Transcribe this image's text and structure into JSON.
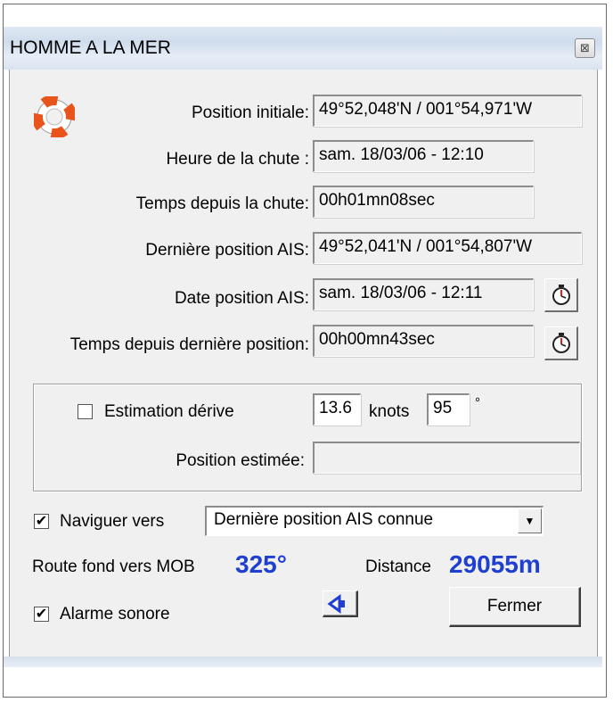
{
  "window": {
    "title": "HOMME A LA MER",
    "close_icon_glyph": "⊠"
  },
  "fields": {
    "position_initiale": {
      "label": "Position initiale:",
      "value": "49°52,048'N / 001°54,971'W"
    },
    "heure_chute": {
      "label": "Heure de la chute :",
      "value": "sam. 18/03/06 - 12:10"
    },
    "temps_depuis_chute": {
      "label": "Temps depuis la chute:",
      "value": "00h01mn08sec"
    },
    "derniere_position_ais": {
      "label": "Dernière position AIS:",
      "value": "49°52,041'N / 001°54,807'W"
    },
    "date_position_ais": {
      "label": "Date position AIS:",
      "value": "sam. 18/03/06 - 12:11"
    },
    "temps_depuis_derniere": {
      "label": "Temps depuis dernière position:",
      "value": "00h00mn43sec"
    }
  },
  "estimation": {
    "checkbox_label": "Estimation dérive",
    "checked": false,
    "speed": "13.6",
    "speed_unit": "knots",
    "heading": "95",
    "heading_unit": "°",
    "position_estimee_label": "Position estimée:",
    "position_estimee_value": ""
  },
  "navigate": {
    "checkbox_label": "Naviguer vers",
    "checked": true,
    "selected_option": "Dernière position AIS connue"
  },
  "route": {
    "label": "Route fond vers MOB",
    "value": "325°",
    "distance_label": "Distance",
    "distance_value": "29055m"
  },
  "alarm": {
    "checkbox_label": "Alarme sonore",
    "checked": true
  },
  "buttons": {
    "close_label": "Fermer"
  },
  "colors": {
    "accent_blue": "#1f3fd1",
    "lifebuoy_orange": "#e8541c"
  },
  "icons": {
    "lifebuoy": "lifebuoy-icon",
    "stopwatch": "stopwatch-icon",
    "sound": "speaker-icon",
    "dropdown": "chevron-down-icon"
  }
}
